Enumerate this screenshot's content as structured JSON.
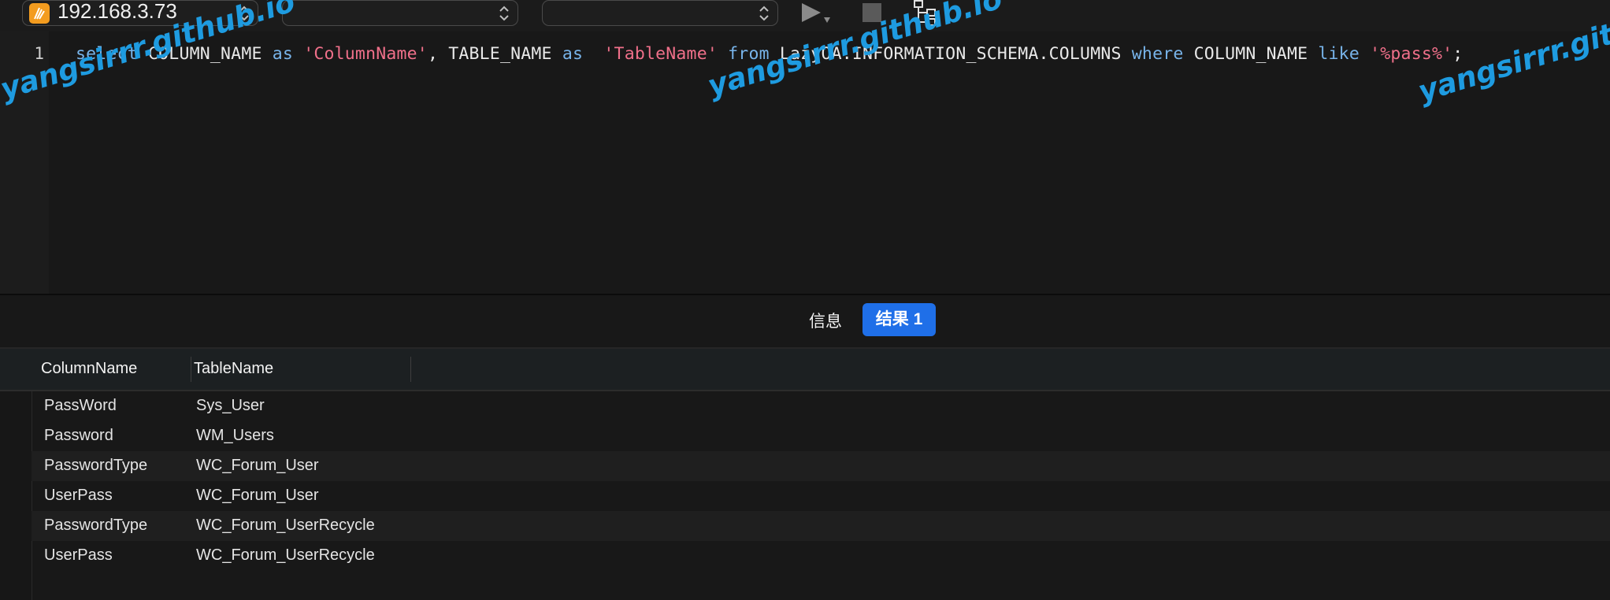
{
  "toolbar": {
    "connection": "192.168.3.73",
    "database_select": "",
    "schema_select": "",
    "icons": [
      "server-icon",
      "chevron-updown-icon",
      "run-icon",
      "stop-icon",
      "explain-icon"
    ]
  },
  "editor": {
    "line_number": "1",
    "tokens": [
      {
        "t": "select",
        "c": "kw"
      },
      {
        "t": " COLUMN_NAME ",
        "c": ""
      },
      {
        "t": "as",
        "c": "kw"
      },
      {
        "t": " ",
        "c": ""
      },
      {
        "t": "'ColumnName'",
        "c": "str"
      },
      {
        "t": ", TABLE_NAME ",
        "c": ""
      },
      {
        "t": "as",
        "c": "kw"
      },
      {
        "t": "  ",
        "c": ""
      },
      {
        "t": "'TableName'",
        "c": "str"
      },
      {
        "t": " ",
        "c": ""
      },
      {
        "t": "from",
        "c": "kw"
      },
      {
        "t": " LazyOA.INFORMATION_SCHEMA.COLUMNS ",
        "c": ""
      },
      {
        "t": "where",
        "c": "kw"
      },
      {
        "t": " COLUMN_NAME ",
        "c": ""
      },
      {
        "t": "like",
        "c": "kw"
      },
      {
        "t": " ",
        "c": ""
      },
      {
        "t": "'%pass%'",
        "c": "str"
      },
      {
        "t": ";",
        "c": ""
      }
    ]
  },
  "tabs": {
    "info": "信息",
    "result": "结果 1"
  },
  "grid": {
    "columns": [
      "ColumnName",
      "TableName"
    ],
    "rows": [
      [
        "PassWord",
        "Sys_User"
      ],
      [
        "Password",
        "WM_Users"
      ],
      [
        "PasswordType",
        "WC_Forum_User"
      ],
      [
        "UserPass",
        "WC_Forum_User"
      ],
      [
        "PasswordType",
        "WC_Forum_UserRecycle"
      ],
      [
        "UserPass",
        "WC_Forum_UserRecycle"
      ]
    ]
  },
  "watermarks": [
    "yangsirrr.github.io",
    "yangsirrr.github.io",
    "yangsirrr.githu"
  ],
  "colors": {
    "background": "#181818",
    "keyword": "#78b4ea",
    "string": "#f0708a",
    "accent": "#1f6fe8",
    "watermark": "#1e9be0",
    "connection_icon": "#f39c1f"
  }
}
